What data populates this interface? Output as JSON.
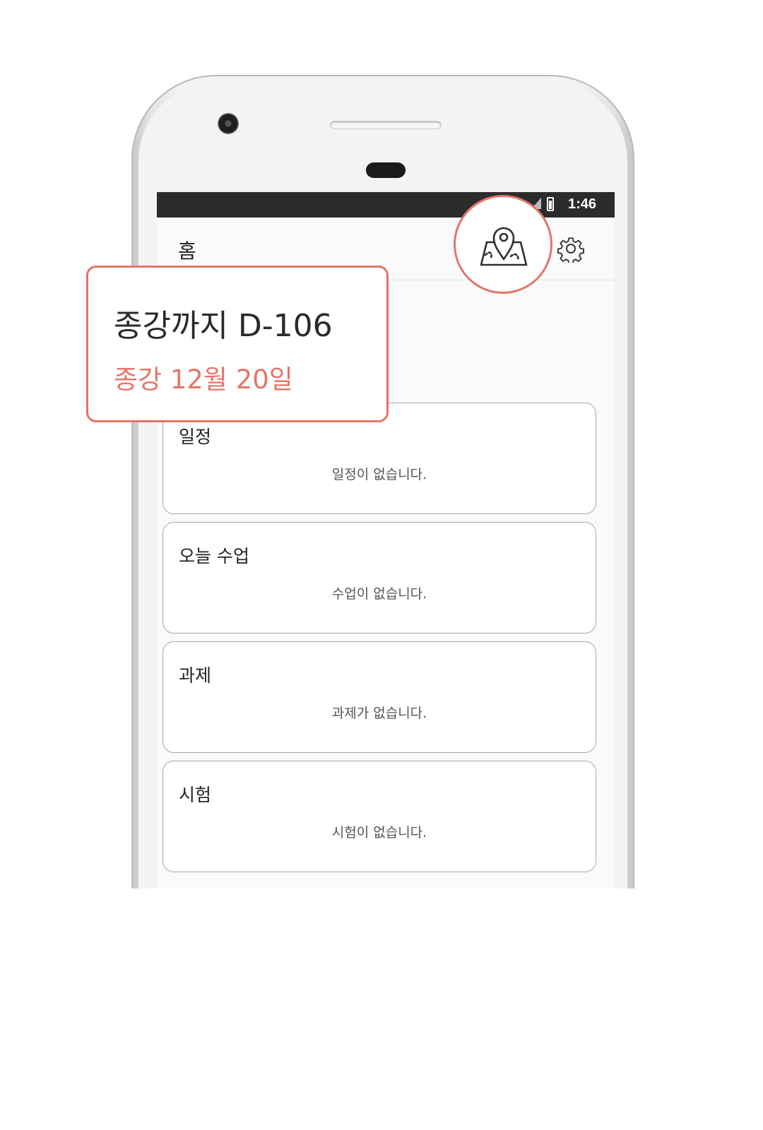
{
  "status_bar": {
    "time": "1:46"
  },
  "app_bar": {
    "title": "홈",
    "map_icon": "map-pin-icon",
    "settings_icon": "gear-icon"
  },
  "dday": {
    "countdown": "종강까지 D-106",
    "end_date": "종강 12월 20일"
  },
  "cards": [
    {
      "title": "일정",
      "empty": "일정이 없습니다."
    },
    {
      "title": "오늘 수업",
      "empty": "수업이 없습니다."
    },
    {
      "title": "과제",
      "empty": "과제가 없습니다."
    },
    {
      "title": "시험",
      "empty": "시험이 없습니다."
    }
  ],
  "colors": {
    "accent": "#e4756a",
    "status_bar": "#2b2b2b",
    "card_border": "#a9a9a9"
  }
}
